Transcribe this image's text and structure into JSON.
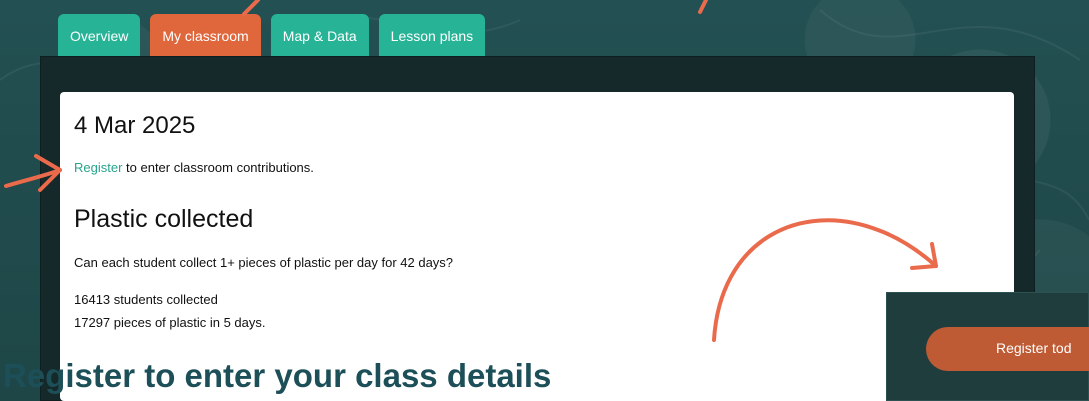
{
  "tabs": [
    {
      "label": "Overview"
    },
    {
      "label": "My classroom"
    },
    {
      "label": "Map & Data"
    },
    {
      "label": "Lesson plans"
    }
  ],
  "card": {
    "date": "4 Mar 2025",
    "register_link": "Register",
    "register_text": " to enter classroom contributions.",
    "section_title": "Plastic collected",
    "question": "Can each student collect 1+ pieces of plastic per day for 42 days?",
    "students_line": "16413 students collected",
    "pieces_line": "17297 pieces of plastic in 5 days."
  },
  "inset": {
    "button_label": "Register tod"
  },
  "caption": "Register to enter your class details",
  "colors": {
    "accent_orange": "#e0663b",
    "tab_teal": "#27b396",
    "link_teal": "#27a58d",
    "caption_text": "#1d4f58"
  }
}
